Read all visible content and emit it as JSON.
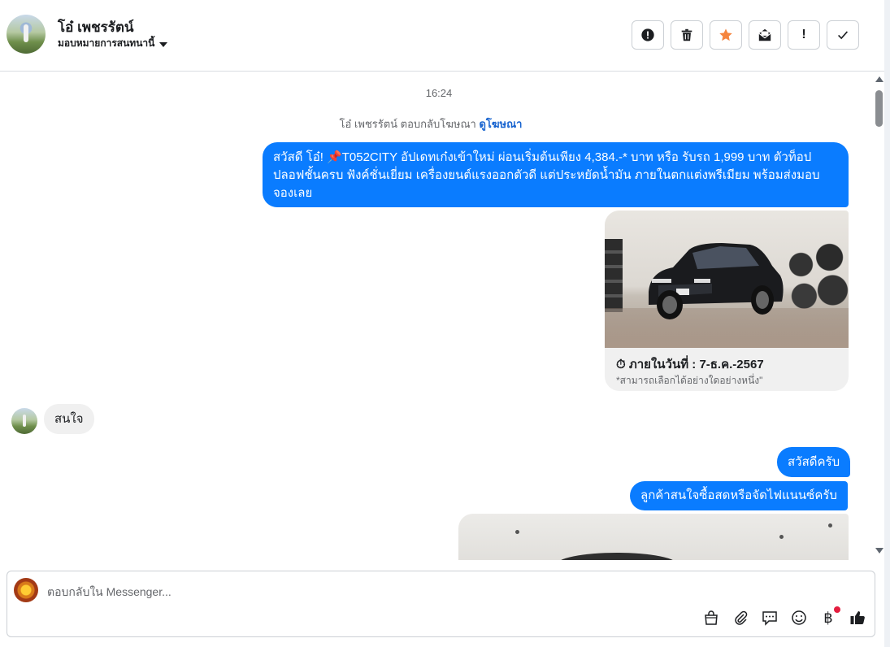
{
  "header": {
    "contact_name": "โอ๋ เพชรรัตน์",
    "assign_label": "มอบหมายการสนทนานี้",
    "actions": [
      {
        "name": "spam-alert",
        "icon": "exclamation-circle-icon"
      },
      {
        "name": "delete",
        "icon": "trash-icon"
      },
      {
        "name": "star",
        "icon": "star-icon",
        "color": "#f5853f"
      },
      {
        "name": "mark-unread",
        "icon": "envelope-open-icon"
      },
      {
        "name": "follow-up",
        "icon": "exclamation-icon",
        "label": "!"
      },
      {
        "name": "mark-done",
        "icon": "check-icon"
      }
    ]
  },
  "thread": {
    "timestamp": "16:24",
    "ad_reply_text": "โอ๋ เพชรรัตน์ ตอบกลับโฆษณา",
    "ad_reply_link": "ดูโฆษณา",
    "msg1_text": "สวัสดี โอ๋! 📌T052CITY  อัปเดทเก๋งเข้าใหม่ ผ่อนเริ่มต้นเพียง 4,384.-* บาท หรือ รับรถ 1,999 บาท ตัวท็อป ปลอฟชั้นครบ ฟังค์ชั่นเยี่ยม เครื่องยนต์แรงออกตัวดี แต่ประหยัดน้ำมัน ภายในตกแต่งพรีเมียม พร้อมส่งมอบ จองเลย",
    "card_title": "⏱ ภายในวันที่ : 7-ธ.ค.-2567",
    "card_subtitle": "*สามารถเลือกได้อย่างใดอย่างหนึ่ง\"",
    "incoming_text": "สนใจ",
    "msg2_text": "สวัสดีครับ",
    "msg3_text": "ลูกค้าสนใจซื้อสดหรือจัดไฟแนนซ์ครับ"
  },
  "composer": {
    "placeholder": "ตอบกลับใน Messenger...",
    "tools": [
      "shopping-bag-icon",
      "paperclip-icon",
      "saved-replies-icon",
      "emoji-icon",
      "baht-icon",
      "thumbs-up-icon"
    ],
    "baht_symbol": "฿"
  },
  "colors": {
    "outgoing_bubble": "#0a7cff",
    "incoming_bubble": "#f0f0f0",
    "link": "#1763cf",
    "star": "#f5853f",
    "notification_dot": "#e41e3f"
  }
}
